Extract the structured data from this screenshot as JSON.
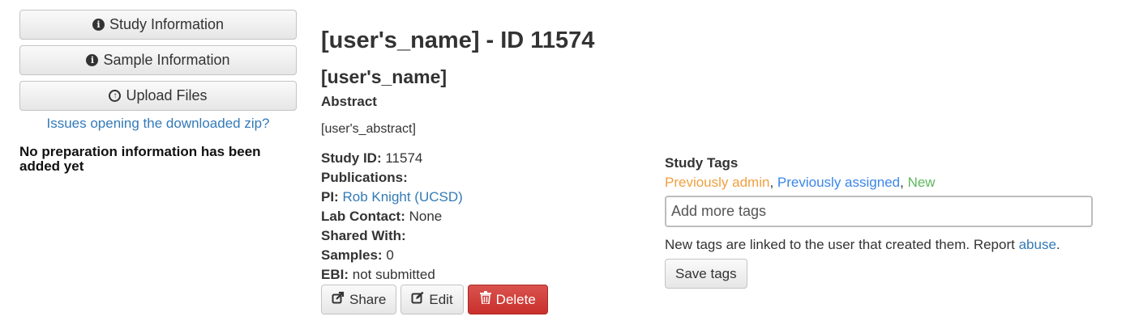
{
  "sidebar": {
    "study_info_label": "Study Information",
    "sample_info_label": "Sample Information",
    "upload_files_label": "Upload Files",
    "zip_issue_link": "Issues opening the downloaded zip?",
    "no_prep_message": "No preparation information has been added yet"
  },
  "study": {
    "title": "[user's_name] - ID 11574",
    "name": "[user's_name]",
    "abstract_label": "Abstract",
    "abstract_text": "[user's_abstract]",
    "study_id_label": "Study ID:",
    "study_id_value": "11574",
    "publications_label": "Publications:",
    "pi_label": "PI:",
    "pi_value": "Rob Knight (UCSD)",
    "lab_contact_label": "Lab Contact:",
    "lab_contact_value": "None",
    "shared_with_label": "Shared With:",
    "samples_label": "Samples:",
    "samples_value": "0",
    "ebi_label": "EBI:",
    "ebi_value": "not submitted"
  },
  "actions": {
    "share_label": "Share",
    "edit_label": "Edit",
    "delete_label": "Delete"
  },
  "tags": {
    "title": "Study Tags",
    "admin_tag": "Previously admin",
    "assigned_tag": "Previously assigned",
    "new_tag": "New",
    "input_placeholder": "Add more tags",
    "note_text": "New tags are linked to the user that created them. Report",
    "abuse_link": "abuse",
    "save_label": "Save tags"
  },
  "colors": {
    "link": "#337ab7",
    "delete": "#d9534f",
    "tag_admin": "#f0a040",
    "tag_assigned": "#3a87e8",
    "tag_new": "#5cb85c"
  }
}
